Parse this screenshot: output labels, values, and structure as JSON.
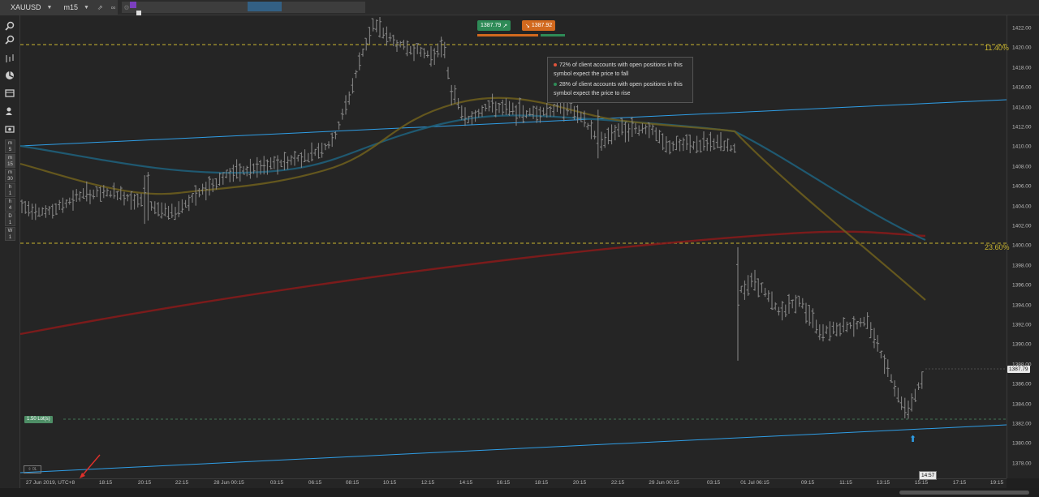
{
  "toolbar": {
    "symbol": "XAUUSD",
    "timeframe": "m15",
    "detach_icon": "⇗",
    "link_icon": "∞",
    "settings_icon": "⚙",
    "symbol_color": "#f4c430"
  },
  "sidebar": {
    "zoom_in_icon": "🔍",
    "zoom_out_icon": "🔍",
    "timeframes": [
      {
        "top": "m",
        "bottom": "5"
      },
      {
        "top": "m",
        "bottom": "15"
      },
      {
        "top": "m",
        "bottom": "30"
      },
      {
        "top": "h",
        "bottom": "1"
      },
      {
        "top": "h",
        "bottom": "4"
      },
      {
        "top": "D",
        "bottom": "1"
      },
      {
        "top": "W",
        "bottom": "1"
      }
    ]
  },
  "chart": {
    "buy_price": "1387.79",
    "sell_price": "1387.92",
    "current_price": "1387.79",
    "time_marker": "14:57",
    "fib_upper": "11.40%",
    "fib_lower": "23.60%",
    "lot_label": "1.50 Lot(s)",
    "mini_label": "⇳ 0L",
    "sentiment_fall": "72% of client accounts with open positions in this symbol expect the price to fall",
    "sentiment_rise": "28% of client accounts with open positions in this symbol expect the price to rise",
    "colors": {
      "buy": "#2e8b57",
      "sell": "#d2691e",
      "fib": "#c9b52f",
      "trend": "#2f9ee6",
      "ma_red": "#8b1a1a"
    }
  },
  "price_axis": [
    "1422.00",
    "1420.00",
    "1418.00",
    "1416.00",
    "1414.00",
    "1412.00",
    "1410.00",
    "1408.00",
    "1406.00",
    "1404.00",
    "1402.00",
    "1400.00",
    "1398.00",
    "1396.00",
    "1394.00",
    "1392.00",
    "1390.00",
    "1388.00",
    "1386.00",
    "1384.00",
    "1382.00",
    "1380.00",
    "1378.00"
  ],
  "time_axis": [
    "27 Jun 2019, UTC+8",
    "18:15",
    "20:15",
    "22:15",
    "28 Jun 00:15",
    "03:15",
    "06:15",
    "08:15",
    "10:15",
    "12:15",
    "14:15",
    "16:15",
    "18:15",
    "20:15",
    "22:15",
    "29 Jun 00:15",
    "03:15",
    "01 Jul 06:15",
    "09:15",
    "11:15",
    "13:15",
    "15:15",
    "17:15",
    "19:15"
  ]
}
